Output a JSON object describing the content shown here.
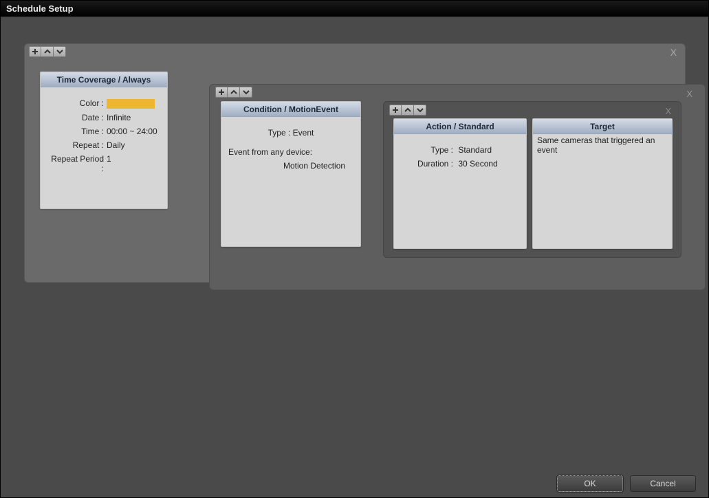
{
  "window": {
    "title": "Schedule Setup"
  },
  "buttons": {
    "ok": "OK",
    "cancel": "Cancel"
  },
  "close": "X",
  "timeCoverage": {
    "header": "Time Coverage / Always",
    "colorLabel": "Color :",
    "colorValue": "#eeb531",
    "dateLabel": "Date :",
    "dateValue": "Infinite",
    "timeLabel": "Time :",
    "timeValue": "00:00 ~ 24:00",
    "repeatLabel": "Repeat :",
    "repeatValue": "Daily",
    "repeatPeriodLabel": "Repeat Period :",
    "repeatPeriodValue": "1"
  },
  "condition": {
    "header": "Condition / MotionEvent",
    "typeLabel": "Type :",
    "typeValue": "Event",
    "sourceLine": "Event from any device:",
    "sourceDetail": "Motion Detection"
  },
  "action": {
    "header": "Action / Standard",
    "typeLabel": "Type :",
    "typeValue": "Standard",
    "durationLabel": "Duration :",
    "durationValue": "30 Second"
  },
  "target": {
    "header": "Target",
    "text": "Same cameras that triggered an event"
  }
}
